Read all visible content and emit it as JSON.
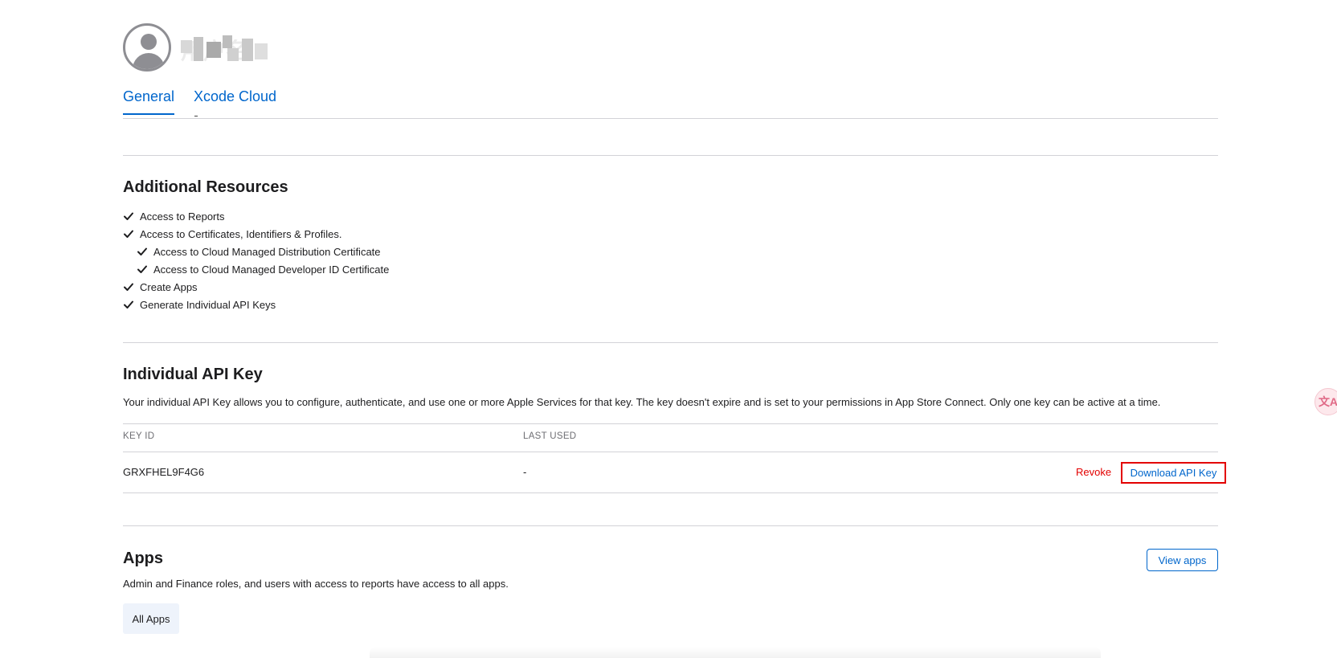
{
  "user": {
    "avatar_icon": "person-circle-icon",
    "display_name": "用户名"
  },
  "tabs": [
    {
      "label": "General",
      "active": true
    },
    {
      "label": "Xcode Cloud",
      "active": false
    }
  ],
  "additional_resources": {
    "title": "Additional Resources",
    "check_icon": "checkmark-icon",
    "items": [
      {
        "label": "Access to Reports",
        "indent": false
      },
      {
        "label": "Access to Certificates, Identifiers & Profiles.",
        "indent": false
      },
      {
        "label": "Access to Cloud Managed Distribution Certificate",
        "indent": true
      },
      {
        "label": "Access to Cloud Managed Developer ID Certificate",
        "indent": true
      },
      {
        "label": "Create Apps",
        "indent": false
      },
      {
        "label": "Generate Individual API Keys",
        "indent": false
      }
    ]
  },
  "api_key": {
    "title": "Individual API Key",
    "description": "Your individual API Key allows you to configure, authenticate, and use one or more Apple Services for that key. The key doesn't expire and is set to your permissions in App Store Connect. Only one key can be active at a time.",
    "columns": [
      "KEY ID",
      "LAST USED"
    ],
    "row": {
      "key_id": "GRXFHEL9F4G6",
      "last_used": "-"
    },
    "revoke_label": "Revoke",
    "download_label": "Download API Key"
  },
  "apps": {
    "title": "Apps",
    "description": "Admin and Finance roles, and users with access to reports have access to all apps.",
    "view_apps_label": "View apps",
    "chip_label": "All Apps"
  },
  "floating": {
    "translate_icon": "translate-icon",
    "translate_glyph": "文A"
  },
  "colors": {
    "link": "#0066cc",
    "danger": "#e30000",
    "divider": "#d2d2d7",
    "chip_bg": "#eef3fb"
  }
}
